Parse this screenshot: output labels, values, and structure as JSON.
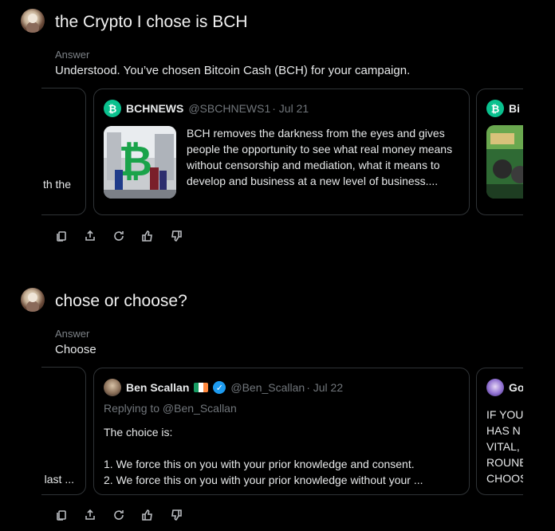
{
  "threads": [
    {
      "question": "the Crypto I chose is BCH",
      "answer_label": "Answer",
      "answer": "Understood. You’ve chosen Bitcoin Cash (BCH) for your campaign.",
      "left_card_fragment": "th the",
      "main_card": {
        "name": "BCHNEWS",
        "handle": "@SBCHNEWS1",
        "date": "· Jul 21",
        "body": "BCH removes the darkness from the eyes and gives people the opportunity to see what real money means without censorship and mediation, what it means to develop and business at a new level of business...."
      },
      "right_card_fragment": "Bi"
    },
    {
      "question": "chose or choose?",
      "answer_label": "Answer",
      "answer": "Choose",
      "left_card_fragment": "e last ...",
      "main_card": {
        "name": "Ben Scallan",
        "handle": "@Ben_Scallan",
        "date": "· Jul 22",
        "replying": "Replying to @Ben_Scallan",
        "line1": "The choice is:",
        "line2": "1. We force this on you with your prior knowledge and consent.",
        "line3": "2. We force this on you with your prior knowledge without your ..."
      },
      "right_card_fragment_name": "Go",
      "right_card_fragment_lines": [
        "IF YOU",
        "HAS N",
        "VITAL, I",
        "ROUNE",
        "CHOOS"
      ]
    }
  ],
  "icons": [
    "copy-icon",
    "share-icon",
    "regenerate-icon",
    "thumbs-up-icon",
    "thumbs-down-icon"
  ],
  "colors": {
    "bch_green": "#0ac18e",
    "verified_blue": "#1d9bf0"
  }
}
